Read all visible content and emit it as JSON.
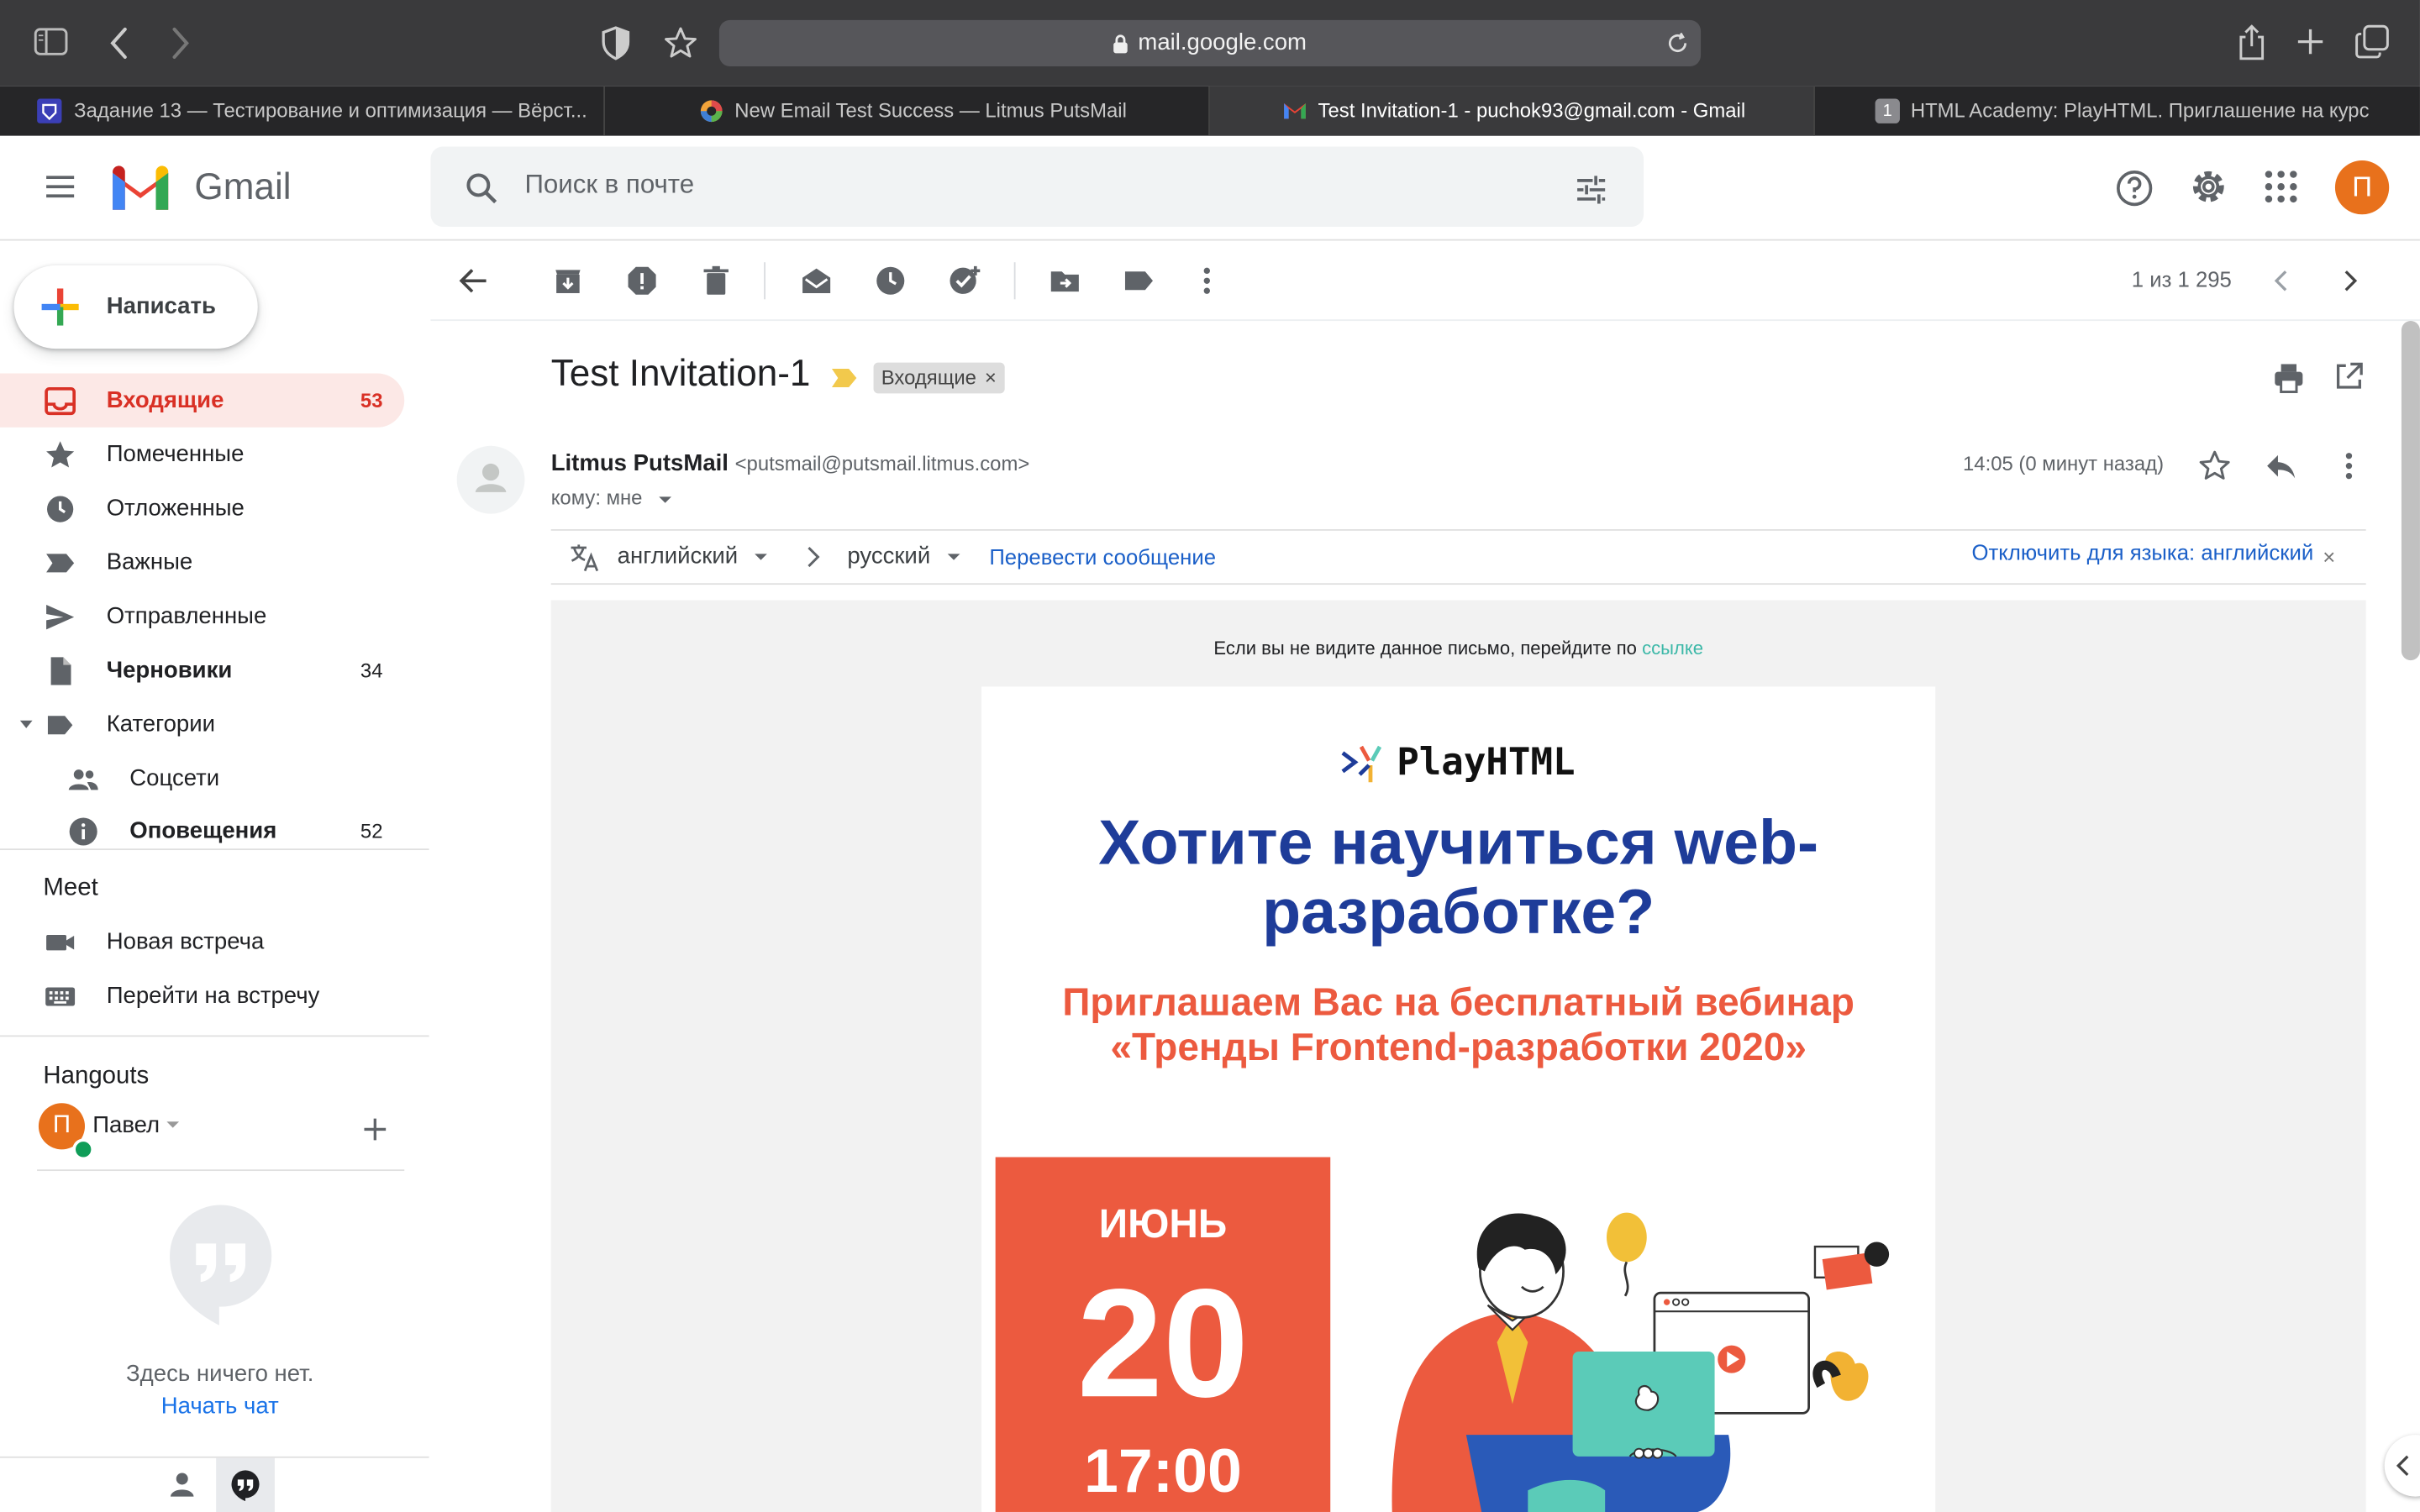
{
  "browser": {
    "url": "mail.google.com",
    "tabs": [
      {
        "title": "Задание 13 — Тестирование и оптимизация — Вёрст...",
        "active": false
      },
      {
        "title": "New Email Test Success — Litmus PutsMail",
        "active": false
      },
      {
        "title": "Test Invitation-1 - puchok93@gmail.com - Gmail",
        "active": true
      },
      {
        "title": "HTML Academy: PlayHTML. Приглашение на курс",
        "active": false
      }
    ],
    "tab4_badge": "1"
  },
  "header": {
    "logo_text": "Gmail",
    "search_placeholder": "Поиск в почте",
    "avatar_letter": "П"
  },
  "sidebar": {
    "compose": "Написать",
    "items": [
      {
        "label": "Входящие",
        "count": "53"
      },
      {
        "label": "Помеченные",
        "count": ""
      },
      {
        "label": "Отложенные",
        "count": ""
      },
      {
        "label": "Важные",
        "count": ""
      },
      {
        "label": "Отправленные",
        "count": ""
      },
      {
        "label": "Черновики",
        "count": "34"
      },
      {
        "label": "Категории",
        "count": ""
      },
      {
        "label": "Соцсети",
        "count": ""
      },
      {
        "label": "Оповещения",
        "count": "52"
      }
    ],
    "meet": {
      "title": "Meet",
      "new_meeting": "Новая встреча",
      "join_meeting": "Перейти на встречу"
    },
    "hangouts": {
      "title": "Hangouts",
      "user": "Павел",
      "user_initial": "П",
      "empty": "Здесь ничего нет.",
      "start_chat": "Начать чат"
    }
  },
  "toolbar": {
    "pagination": "1 из 1 295"
  },
  "message": {
    "subject": "Test Invitation-1",
    "label": "Входящие",
    "sender_name": "Litmus PutsMail",
    "sender_email": "<putsmail@putsmail.litmus.com>",
    "to": "кому: мне",
    "time": "14:05 (0 минут назад)",
    "translate": {
      "from": "английский",
      "to": "русский",
      "action": "Перевести сообщение",
      "disable": "Отключить для языка: английский"
    }
  },
  "email": {
    "preheader": "Если вы не видите данное письмо, перейдите по",
    "preheader_link": "ссылке",
    "brand": "PlayHTML",
    "headline": "Хотите научиться web-разработке?",
    "subheadline": "Приглашаем Вас на бесплатный вебинар «Тренды Frontend-разработки 2020»",
    "month": "ИЮНЬ",
    "day": "20",
    "time": "17:00"
  },
  "colors": {
    "gmail_red": "#d93025",
    "link_blue": "#1a73e8",
    "headline_blue": "#1e3c99",
    "accent_orange": "#ec5a3f",
    "teal": "#5bcbb8"
  }
}
